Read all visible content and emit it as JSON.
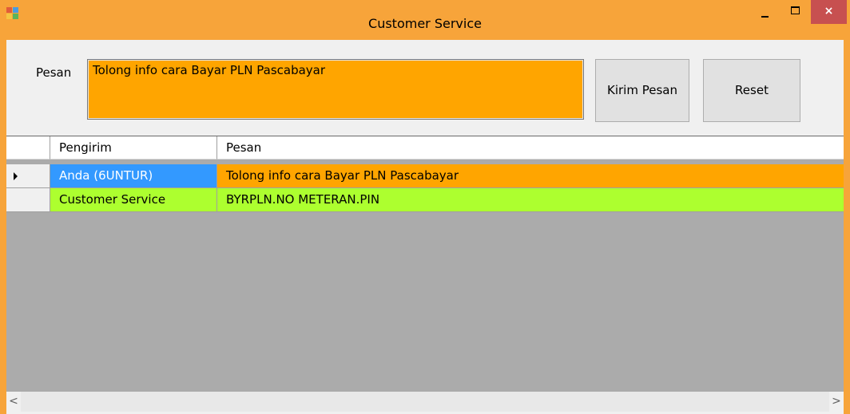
{
  "window": {
    "title": "Customer Service",
    "icon": "windows-form-icon",
    "controls": {
      "minimize": "minimize-icon",
      "maximize": "maximize-icon",
      "close": "×"
    }
  },
  "form": {
    "message_label": "Pesan",
    "message_value": "Tolong info cara Bayar PLN Pascabayar",
    "send_button": "Kirim Pesan",
    "reset_button": "Reset",
    "input_color": "#ffa500"
  },
  "grid": {
    "columns": [
      "Pengirim",
      "Pesan"
    ],
    "selected_row_marker": "right-triangle-icon",
    "rows": [
      {
        "sender": "Anda (6UNTUR)",
        "message": "Tolong info cara Bayar PLN Pascabayar",
        "sender_bg": "#3399ff",
        "sender_fg": "#ffffff",
        "message_bg": "#ffa500"
      },
      {
        "sender": "Customer Service",
        "message": "BYRPLN.NO METERAN.PIN",
        "sender_bg": "#adff2f",
        "sender_fg": "#000000",
        "message_bg": "#adff2f"
      }
    ],
    "empty_area_color": "#ababab"
  },
  "scrollbar": {
    "left": "<",
    "right": ">"
  }
}
